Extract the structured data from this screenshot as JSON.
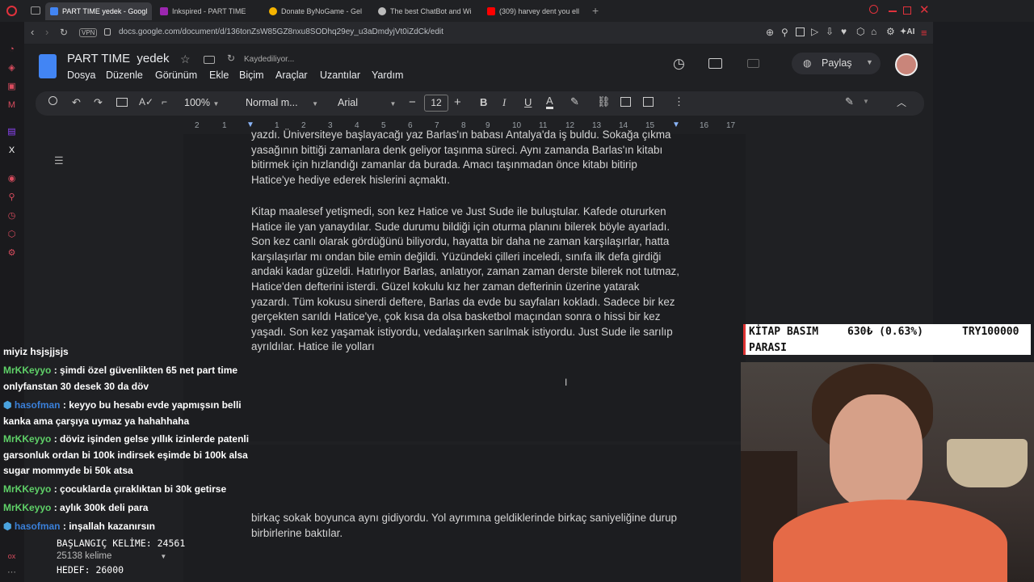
{
  "browser": {
    "tabs": [
      {
        "title": "PART TIME yedek - Googl",
        "active": true,
        "color": "#4285f4"
      },
      {
        "title": "Inkspired - PART TIME",
        "color": "#9c27b0"
      },
      {
        "title": "Donate ByNoGame - Gel",
        "color": "#f5b400"
      },
      {
        "title": "The best ChatBot and Wi",
        "color": "#bbbbbb"
      },
      {
        "title": "(309) harvey dent you ell",
        "color": "#ff0000"
      }
    ],
    "vpn": "VPN",
    "url": "docs.google.com/document/d/136tonZsW85GZ8nxu8SODhq29ey_u3aDmdyjVt0iZdCk/edit",
    "ai_label": "AI"
  },
  "doc": {
    "title": "PART TIME  yedek",
    "saving": "Kaydediliyor...",
    "menus": [
      "Dosya",
      "Düzenle",
      "Görünüm",
      "Ekle",
      "Biçim",
      "Araçlar",
      "Uzantılar",
      "Yardım"
    ],
    "share": "Paylaş",
    "zoom": "100%",
    "style": "Normal m...",
    "font": "Arial",
    "font_size": "12",
    "ruler": [
      "2",
      "1",
      "1",
      "2",
      "3",
      "4",
      "5",
      "6",
      "7",
      "8",
      "9",
      "10",
      "11",
      "12",
      "13",
      "14",
      "15",
      "16",
      "17",
      "18"
    ],
    "paragraphs": [
      "yazdı. Üniversiteye başlayacağı yaz Barlas'ın babası Antalya'da iş buldu. Sokağa çıkma yasağının bittiği zamanlara denk geliyor taşınma süreci. Aynı zamanda Barlas'ın kitabı bitirmek için hızlandığı zamanlar da burada. Amacı taşınmadan önce kitabı bitirip Hatice'ye hediye ederek hislerini açmaktı.",
      "Kitap maalesef yetişmedi, son kez Hatice ve Just Sude ile buluştular. Kafede otururken Hatice ile yan yanaydılar. Sude durumu bildiği için oturma planını bilerek böyle ayarladı. Son kez canlı olarak gördüğünü biliyordu, hayatta bir daha ne zaman karşılaşırlar, hatta karşılaşırlar mı ondan bile emin değildi. Yüzündeki çilleri inceledi, sınıfa ilk defa girdiği andaki kadar güzeldi. Hatırlıyor Barlas, anlatıyor, zaman zaman derste bilerek not tutmaz, Hatice'den defterini isterdi. Güzel kokulu kız her zaman defterinin üzerine yatarak yazardı. Tüm kokusu sinerdi deftere, Barlas da evde bu sayfaları kokladı. Sadece bir kez gerçekten sarıldı Hatice'ye, çok kısa da olsa basketbol maçından sonra o hissi bir kez yaşadı. Son kez yaşamak istiyordu, vedalaşırken sarılmak istiyordu. Just Sude ile sarılıp ayrıldılar. Hatice ile yolları",
      "birkaç sokak boyunca aynı gidiyordu. Yol ayrımına geldiklerinde birkaç saniyeliğine durup birbirlerine baktılar."
    ]
  },
  "chat": [
    {
      "user": "",
      "text": "miyiz hsjsjjsjs"
    },
    {
      "user": "MrKKeyyo",
      "text": ": şimdi özel güvenlikten 65 net part time onlyfanstan 30 desek 30 da döv",
      "badge": false
    },
    {
      "user": "hasofman",
      "text": ": keyyo bu hesabı evde yapmışsın belli kanka ama çarşıya uymaz ya hahahhaha",
      "badge": true
    },
    {
      "user": "MrKKeyyo",
      "text": ": döviz işinden gelse yıllık izinlerde patenli garsonluk ordan bi 100k indirsek eşimde bi 100k alsa sugar mommyde bi 50k atsa",
      "badge": false
    },
    {
      "user": "MrKKeyyo",
      "text": ": çocuklarda çıraklıktan bi 30k getirse",
      "badge": false
    },
    {
      "user": "MrKKeyyo",
      "text": ": aylık 300k deli para",
      "badge": false
    },
    {
      "user": "hasofman",
      "text": ": inşallah kazanırsın",
      "badge": true
    }
  ],
  "ticker": {
    "line1_a": "KİTAP BASIM",
    "line1_b": "630₺ (0.63%)",
    "line1_c": "TRY100000",
    "line2": "PARASI"
  },
  "counter": {
    "start": "BAŞLANGIÇ KELİME: 24561",
    "words": "25138 kelime",
    "target": "HEDEF: 26000"
  }
}
